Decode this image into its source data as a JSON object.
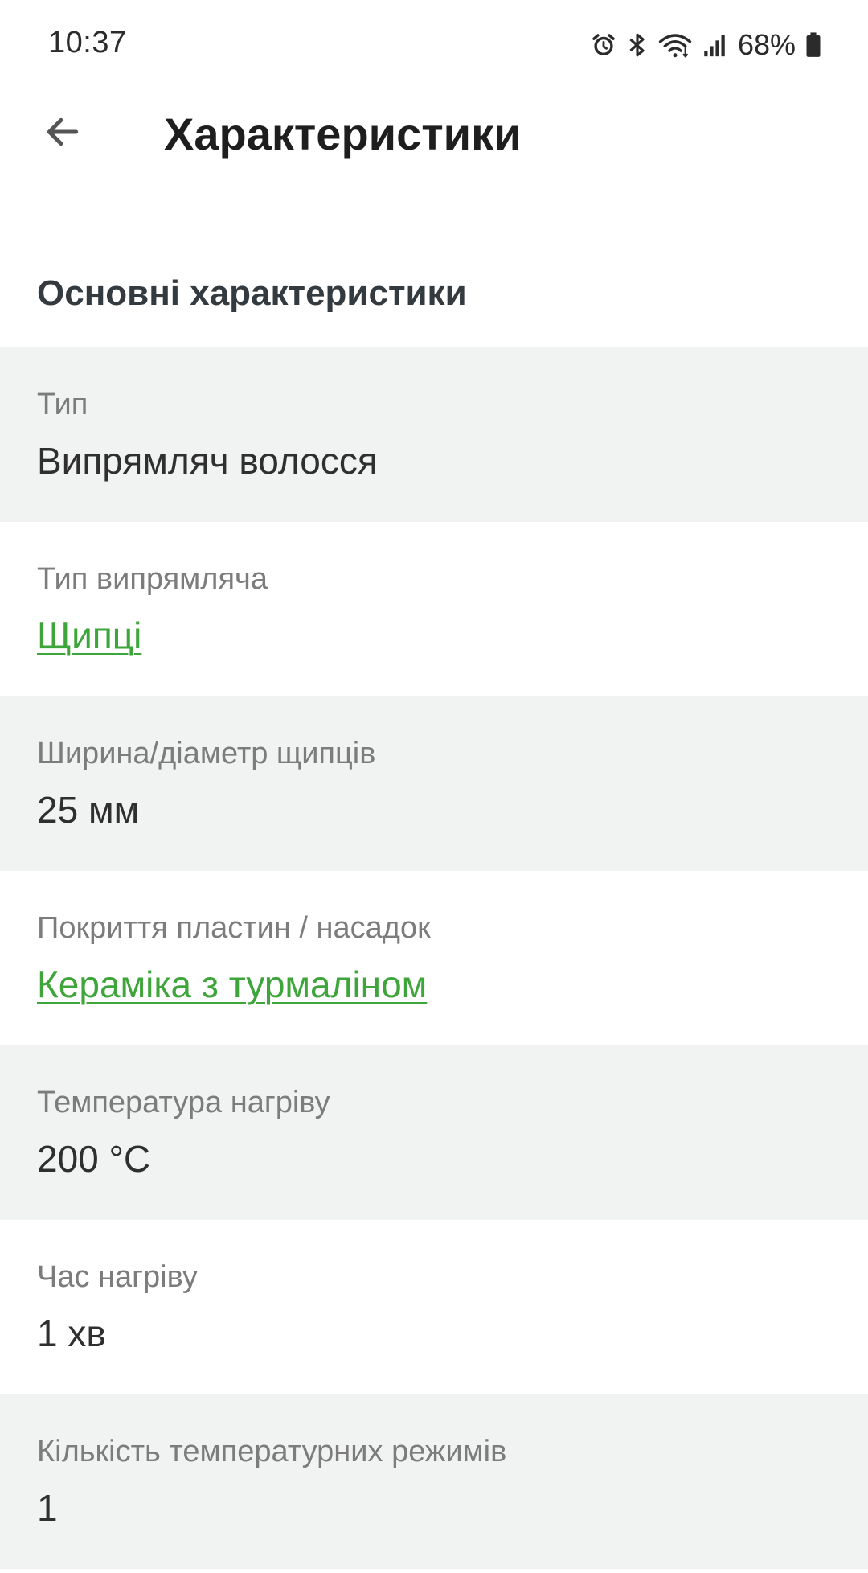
{
  "status_bar": {
    "time": "10:37",
    "battery_percent": "68%",
    "icons": [
      "alarm-icon",
      "bluetooth-icon",
      "wifi-icon",
      "signal-icon",
      "battery-icon"
    ]
  },
  "header": {
    "back_icon": "arrow-left-icon",
    "title": "Характеристики"
  },
  "section": {
    "title": "Основні характеристики"
  },
  "specs": [
    {
      "label": "Тип",
      "value": "Випрямляч волосся",
      "is_link": false
    },
    {
      "label": "Тип випрямляча",
      "value": "Щипці",
      "is_link": true
    },
    {
      "label": "Ширина/діаметр щипців",
      "value": "25 мм",
      "is_link": false
    },
    {
      "label": "Покриття пластин / насадок",
      "value": "Кераміка з турмаліном",
      "is_link": true
    },
    {
      "label": "Температура нагріву",
      "value": "200 °C",
      "is_link": false
    },
    {
      "label": "Час нагріву",
      "value": "1 хв",
      "is_link": false
    },
    {
      "label": "Кількість температурних режимів",
      "value": "1",
      "is_link": false
    }
  ],
  "colors": {
    "link": "#3ea53a",
    "row_shaded": "#f1f2f2",
    "label": "#7c7c7c",
    "value": "#2f2f2f"
  }
}
